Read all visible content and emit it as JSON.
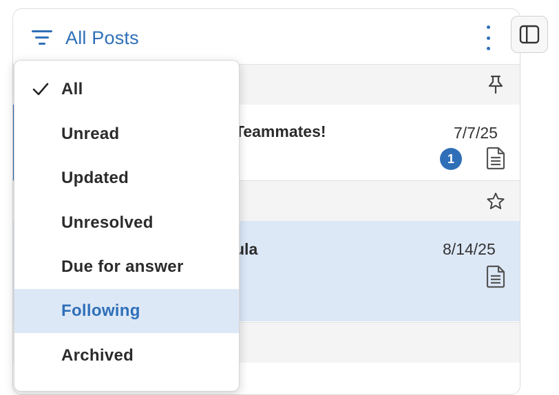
{
  "header": {
    "filter_label": "All Posts"
  },
  "posts": [
    {
      "title_fragment": "Teammates!",
      "date": "7/7/25",
      "badge": "1"
    },
    {
      "title_fragment": "ula",
      "date": "8/14/25"
    }
  ],
  "dropdown": {
    "items": [
      {
        "label": "All",
        "checked": true
      },
      {
        "label": "Unread"
      },
      {
        "label": "Updated"
      },
      {
        "label": "Unresolved"
      },
      {
        "label": "Due for answer"
      },
      {
        "label": "Following",
        "highlighted": true
      },
      {
        "label": "Archived"
      }
    ]
  },
  "colors": {
    "accent": "#2f6fb8",
    "selected_row": "#dde8f7",
    "gray_row": "#f4f4f4"
  }
}
